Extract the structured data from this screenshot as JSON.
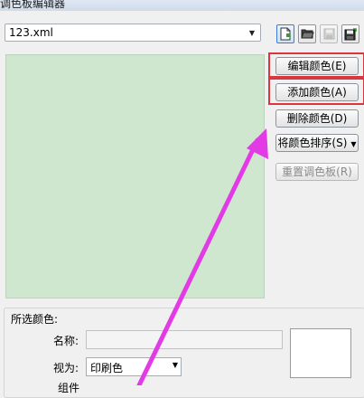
{
  "window": {
    "title": "调色板编辑器"
  },
  "palette_file": {
    "value": "123.xml",
    "arrow": "▼"
  },
  "toolbar": {
    "new_icon": "new-palette-icon",
    "open_icon": "open-folder-icon",
    "save_icon": "save-disk-icon",
    "save_as_icon": "save-as-disk-icon"
  },
  "buttons": {
    "edit": "编辑颜色(E)",
    "add": "添加颜色(A)",
    "delete": "删除颜色(D)",
    "sort": "将颜色排序(S)",
    "sort_caret": "▼",
    "reset": "重置调色板(R)"
  },
  "selected": {
    "group_label": "所选颜色:",
    "name_label": "名称:",
    "name_value": "",
    "view_label": "视为:",
    "view_value": "印刷色",
    "view_arrow": "▼",
    "partial_label": "组件"
  },
  "colors": {
    "preview_bg": "#cfe6cf",
    "highlight": "#d9373d",
    "annotation_arrow": "#e23be6"
  }
}
